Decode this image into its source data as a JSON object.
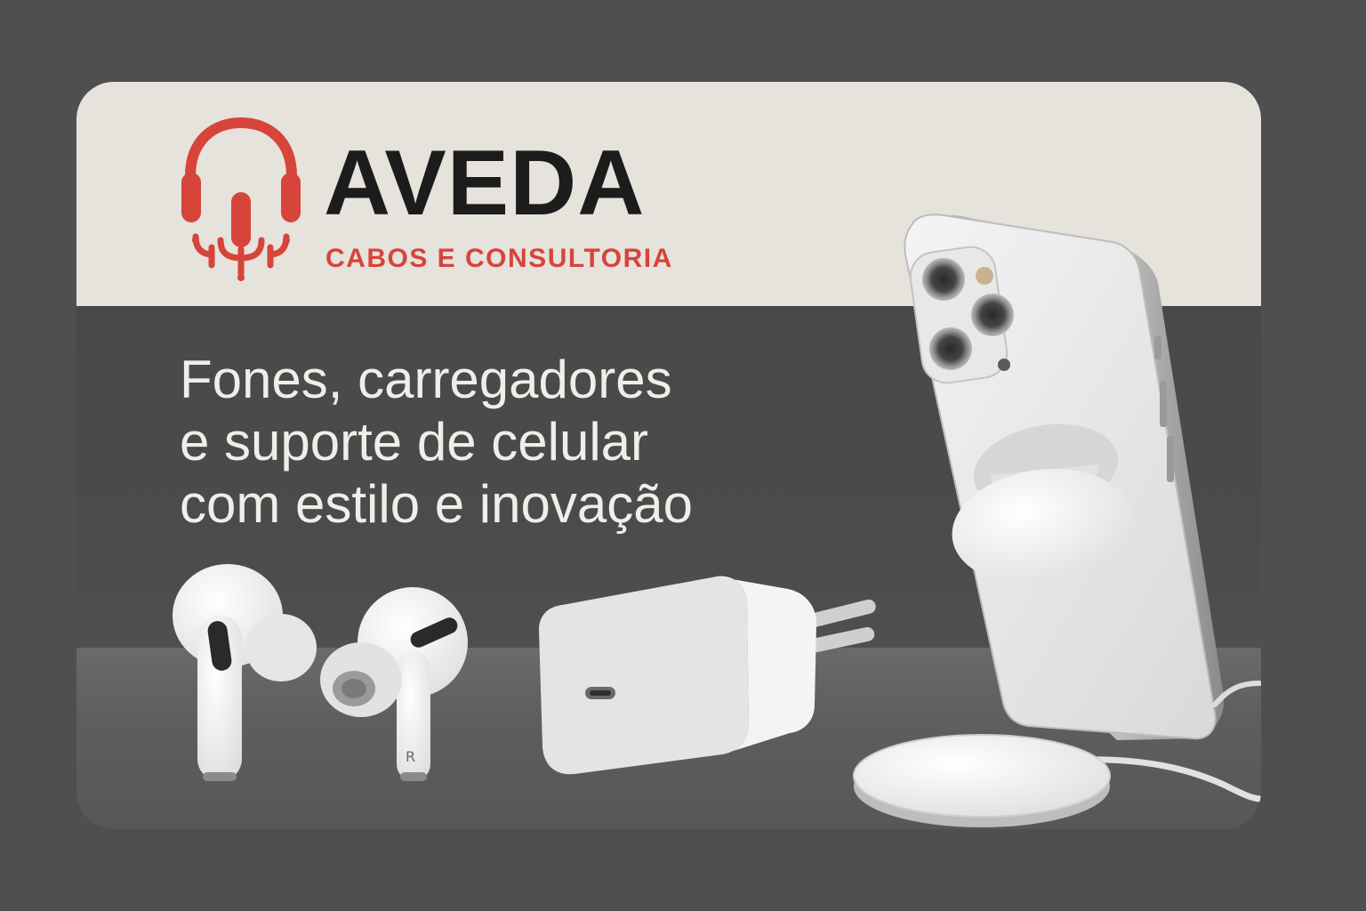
{
  "brand": {
    "name": "AVEDA",
    "tagline": "CABOS E CONSULTORIA",
    "accent_color": "#d6443a",
    "icon": "headset-microphone-icon"
  },
  "headline": {
    "lines": [
      "Fones, carregadores",
      "e suporte de celular",
      "com estilo e inovação"
    ]
  },
  "products": {
    "earbud_mark": "R",
    "items": [
      "earbuds",
      "usb-c-charger",
      "smartphone-with-grip",
      "wireless-charging-pad"
    ]
  },
  "colors": {
    "background": "#4f4f4f",
    "header_band": "#e6e2dc",
    "brand_text": "#1c1c1c",
    "headline_text": "#efefe9"
  }
}
